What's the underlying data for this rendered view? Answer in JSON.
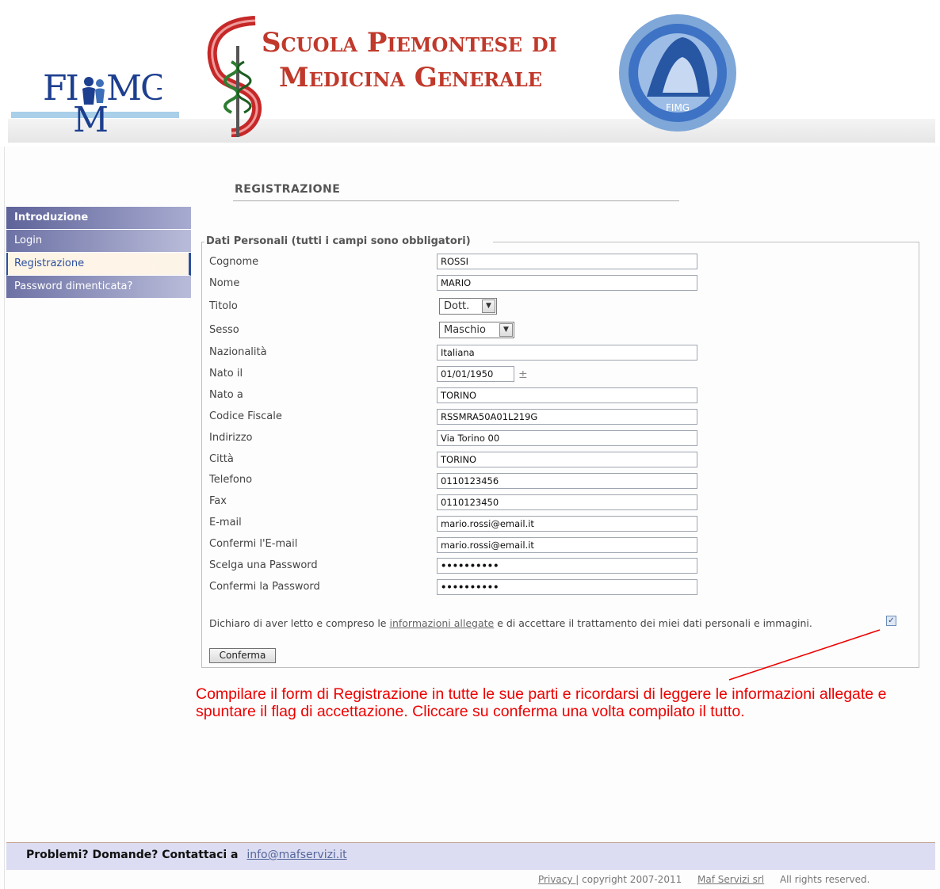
{
  "header": {
    "fimmg_logo": "FIMMG",
    "school_line1": "Scuola Piemontese di",
    "school_line2": "Medicina Generale"
  },
  "sidebar": {
    "items": [
      {
        "label": "Introduzione"
      },
      {
        "label": "Login"
      },
      {
        "label": "Registrazione"
      },
      {
        "label": "Password dimenticata?"
      }
    ]
  },
  "page": {
    "title": "REGISTRAZIONE"
  },
  "form": {
    "legend": "Dati Personali (tutti i campi sono obbligatori)",
    "cognome": {
      "label": "Cognome",
      "value": "ROSSI"
    },
    "nome": {
      "label": "Nome",
      "value": "MARIO"
    },
    "titolo": {
      "label": "Titolo",
      "value": "Dott."
    },
    "sesso": {
      "label": "Sesso",
      "value": "Maschio"
    },
    "nazionalita": {
      "label": "Nazionalità",
      "value": "Italiana"
    },
    "nato_il": {
      "label": "Nato il",
      "value": "01/01/1950"
    },
    "nato_a": {
      "label": "Nato a",
      "value": "TORINO"
    },
    "codice_fiscale": {
      "label": "Codice Fiscale",
      "value": "RSSMRA50A01L219G"
    },
    "indirizzo": {
      "label": "Indirizzo",
      "value": "Via Torino 00"
    },
    "citta": {
      "label": "Città",
      "value": "TORINO"
    },
    "telefono": {
      "label": "Telefono",
      "value": "0110123456"
    },
    "fax": {
      "label": "Fax",
      "value": "0110123450"
    },
    "email": {
      "label": "E-mail",
      "value": "mario.rossi@email.it"
    },
    "conferma_email": {
      "label": "Confermi l'E-mail",
      "value": "mario.rossi@email.it"
    },
    "password": {
      "label": "Scelga una Password",
      "value": "••••••••••"
    },
    "conferma_password": {
      "label": "Confermi la Password",
      "value": "••••••••••"
    },
    "declaration_before": "Dichiaro di aver letto e compreso le",
    "declaration_link": "informazioni allegate",
    "declaration_after": "e di accettare il trattamento dei miei dati personali e immagini.",
    "consent_checked": true,
    "submit_label": "Conferma"
  },
  "annotation": {
    "text": "Compilare il form di Registrazione in tutte le sue parti e ricordarsi di leggere le informazioni allegate e spuntare il flag di accettazione. Cliccare su conferma una volta compilato il tutto.",
    "color": "#e00000"
  },
  "footer": {
    "question": "Problemi? Domande? Contattaci a",
    "contact_email": "info@mafservizi.it",
    "privacy": "Privacy |",
    "copyright": "copyright 2007-2011",
    "company": "Maf Servizi srl",
    "rights": "All rights reserved."
  }
}
